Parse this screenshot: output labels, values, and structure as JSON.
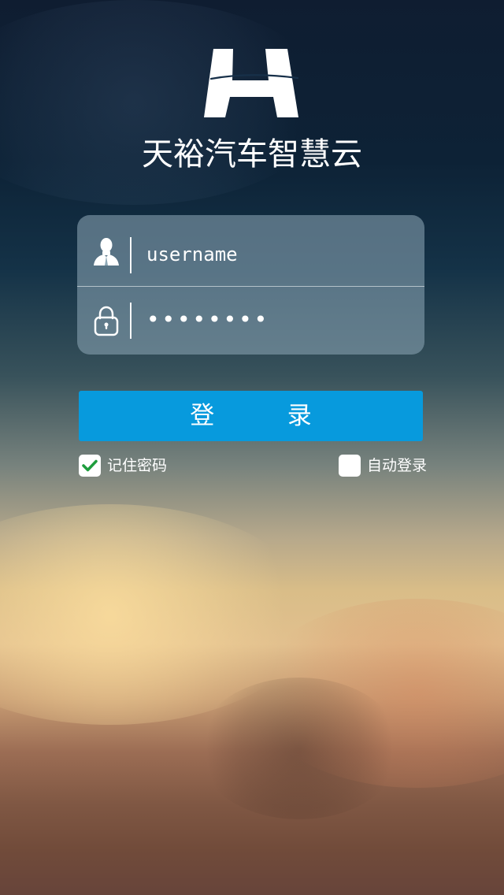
{
  "app": {
    "title": "天裕汽车智慧云"
  },
  "icons": {
    "logo": "brand-logo",
    "user": "user-icon",
    "lock": "lock-icon",
    "check": "checkmark-icon"
  },
  "colors": {
    "login_button": "#079add",
    "checkbox_fill": "#ffffff",
    "checkmark": "#1e9d3d"
  },
  "login_form": {
    "username_value": "username",
    "password_mask": "••••••••",
    "submit_label": "登 录"
  },
  "options": {
    "remember_password": {
      "label": "记住密码",
      "checked": true
    },
    "auto_login": {
      "label": "自动登录",
      "checked": false
    }
  }
}
